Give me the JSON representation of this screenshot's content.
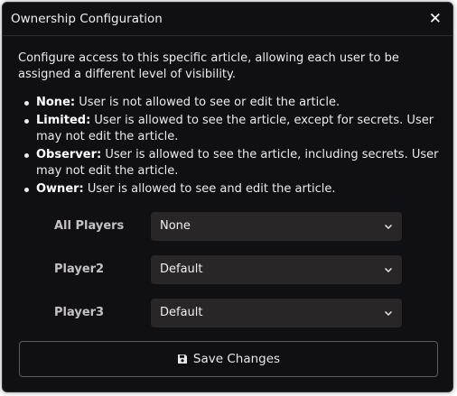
{
  "dialog": {
    "title": "Ownership Configuration",
    "close_icon": "close-icon",
    "intro": "Configure access to this specific article, allowing each user to be assigned a different level of visibility.",
    "levels": [
      {
        "name": "None:",
        "desc": " User is not allowed to see or edit the article."
      },
      {
        "name": "Limited:",
        "desc": " User is allowed to see the article, except for secrets. User may not edit the article."
      },
      {
        "name": "Observer:",
        "desc": " User is allowed to see the article, including secrets. User may not edit the article."
      },
      {
        "name": "Owner:",
        "desc": " User is allowed to see and edit the article."
      }
    ],
    "permissions": [
      {
        "label": "All Players",
        "value": "None"
      },
      {
        "label": "Player2",
        "value": "Default"
      },
      {
        "label": "Player3",
        "value": "Default"
      }
    ],
    "save_button": {
      "label": "Save Changes",
      "icon": "floppy-disk-icon"
    }
  },
  "colors": {
    "background": "#0f0f14",
    "select_bg": "#2a2527",
    "border": "#5a5a62"
  }
}
